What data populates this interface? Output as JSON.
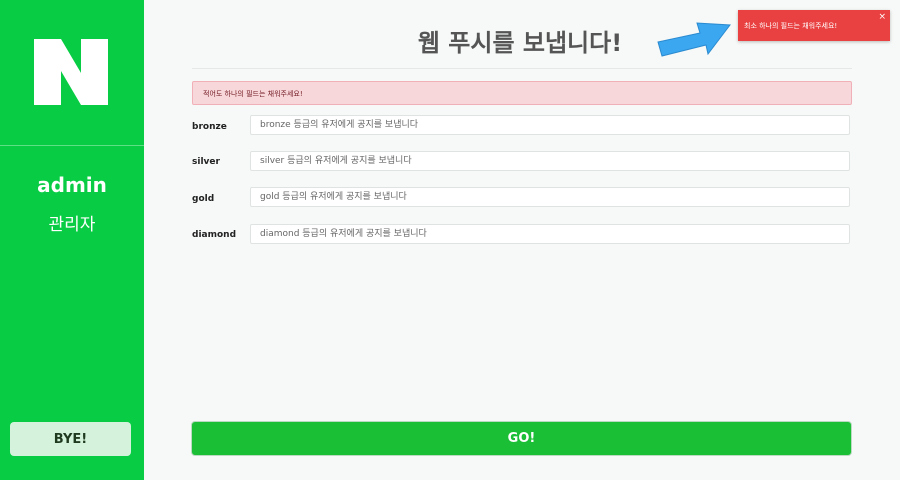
{
  "colors": {
    "sidebar": "#08cd44",
    "go_button": "#1bbf35",
    "toast": "#e94141",
    "alert_bg": "#f8d7da",
    "arrow": "#3aa7f0"
  },
  "sidebar": {
    "logo_icon": "n-logo-icon",
    "user_name": "admin",
    "user_role": "관리자",
    "bye_label": "BYE!"
  },
  "header": {
    "title": "웹 푸시를 보냅니다!"
  },
  "toast": {
    "message": "최소 하나의 필드는 채워주세요!",
    "close": "×"
  },
  "alert": {
    "message": "적어도 하나의 필드는 채워주세요!"
  },
  "fields": [
    {
      "label": "bronze",
      "placeholder": "bronze 등급의 유저에게 공지를 보냅니다"
    },
    {
      "label": "silver",
      "placeholder": "silver 등급의 유저에게 공지를 보냅니다"
    },
    {
      "label": "gold",
      "placeholder": "gold 등급의 유저에게 공지를 보냅니다"
    },
    {
      "label": "diamond",
      "placeholder": "diamond 등급의 유저에게 공지를 보냅니다"
    }
  ],
  "go_label": "GO!"
}
